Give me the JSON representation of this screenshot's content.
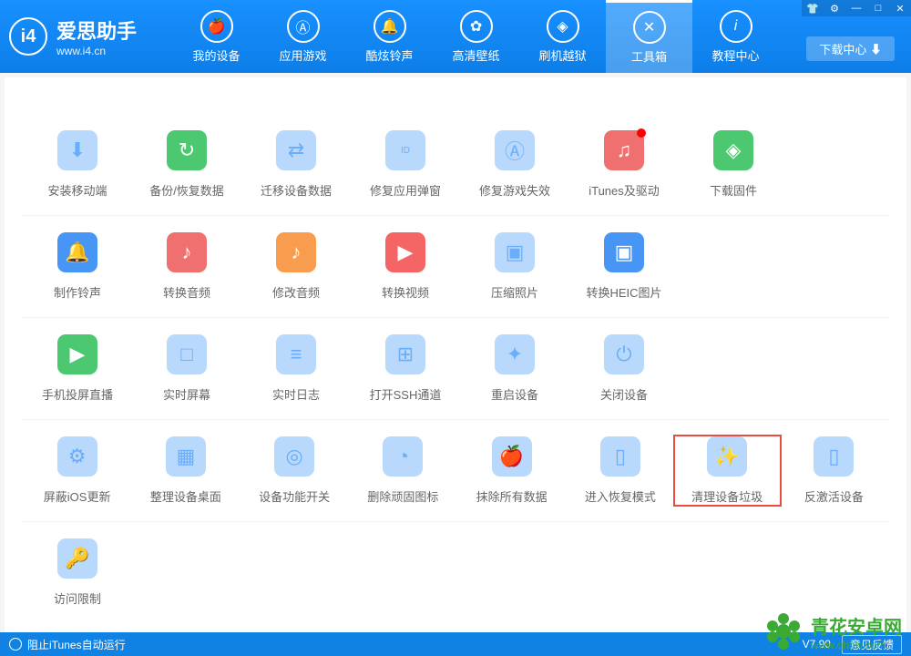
{
  "app": {
    "title": "爱思助手",
    "url": "www.i4.cn",
    "logo_text": "i4"
  },
  "window_controls": {
    "shirt": "👕",
    "settings": "⚙",
    "minimize": "—",
    "maximize": "□",
    "close": "✕"
  },
  "download_center": "下载中心 ⬇",
  "nav": {
    "tabs": [
      {
        "label": "我的设备",
        "icon": "apple"
      },
      {
        "label": "应用游戏",
        "icon": "A"
      },
      {
        "label": "酷炫铃声",
        "icon": "bell"
      },
      {
        "label": "高清壁纸",
        "icon": "flower"
      },
      {
        "label": "刷机越狱",
        "icon": "box"
      },
      {
        "label": "工具箱",
        "icon": "tools",
        "active": true
      },
      {
        "label": "教程中心",
        "icon": "i"
      }
    ]
  },
  "tools": {
    "rows": [
      [
        {
          "label": "安装移动端",
          "color": "blue-light",
          "glyph": "⬇"
        },
        {
          "label": "备份/恢复数据",
          "color": "green",
          "glyph": "↻"
        },
        {
          "label": "迁移设备数据",
          "color": "blue-light",
          "glyph": "⇄"
        },
        {
          "label": "修复应用弹窗",
          "color": "blue-light",
          "glyph": "ID"
        },
        {
          "label": "修复游戏失效",
          "color": "blue-light",
          "glyph": "Ⓐ"
        },
        {
          "label": "iTunes及驱动",
          "color": "pink",
          "glyph": "♫",
          "notification": true
        },
        {
          "label": "下载固件",
          "color": "green",
          "glyph": "◈"
        }
      ],
      [
        {
          "label": "制作铃声",
          "color": "blue",
          "glyph": "🔔"
        },
        {
          "label": "转换音频",
          "color": "pink",
          "glyph": "♪"
        },
        {
          "label": "修改音频",
          "color": "orange",
          "glyph": "♪"
        },
        {
          "label": "转换视频",
          "color": "red",
          "glyph": "▶"
        },
        {
          "label": "压缩照片",
          "color": "blue-light",
          "glyph": "▣"
        },
        {
          "label": "转换HEIC图片",
          "color": "blue",
          "glyph": "▣"
        }
      ],
      [
        {
          "label": "手机投屏直播",
          "color": "green",
          "glyph": "▶"
        },
        {
          "label": "实时屏幕",
          "color": "blue-light",
          "glyph": "□"
        },
        {
          "label": "实时日志",
          "color": "blue-light",
          "glyph": "≡"
        },
        {
          "label": "打开SSH通道",
          "color": "blue-light",
          "glyph": "⊞"
        },
        {
          "label": "重启设备",
          "color": "blue-light",
          "glyph": "✦"
        },
        {
          "label": "关闭设备",
          "color": "blue-light",
          "glyph": "⏻"
        }
      ],
      [
        {
          "label": "屏蔽iOS更新",
          "color": "blue-light",
          "glyph": "⚙"
        },
        {
          "label": "整理设备桌面",
          "color": "blue-light",
          "glyph": "▦"
        },
        {
          "label": "设备功能开关",
          "color": "blue-light",
          "glyph": "◎"
        },
        {
          "label": "删除顽固图标",
          "color": "blue-light",
          "glyph": "◔"
        },
        {
          "label": "抹除所有数据",
          "color": "blue-light",
          "glyph": "🍎"
        },
        {
          "label": "进入恢复模式",
          "color": "blue-light",
          "glyph": "▯"
        },
        {
          "label": "清理设备垃圾",
          "color": "blue-light",
          "glyph": "✨",
          "highlighted": true
        },
        {
          "label": "反激活设备",
          "color": "blue-light",
          "glyph": "▯"
        }
      ],
      [
        {
          "label": "访问限制",
          "color": "blue-light",
          "glyph": "🔑"
        }
      ]
    ]
  },
  "footer": {
    "itunes_block": "阻止iTunes自动运行",
    "version": "V7.90",
    "feedback": "意见反馈"
  },
  "watermark": {
    "title": "青花安卓网",
    "url": "www.qhhlv.com"
  }
}
